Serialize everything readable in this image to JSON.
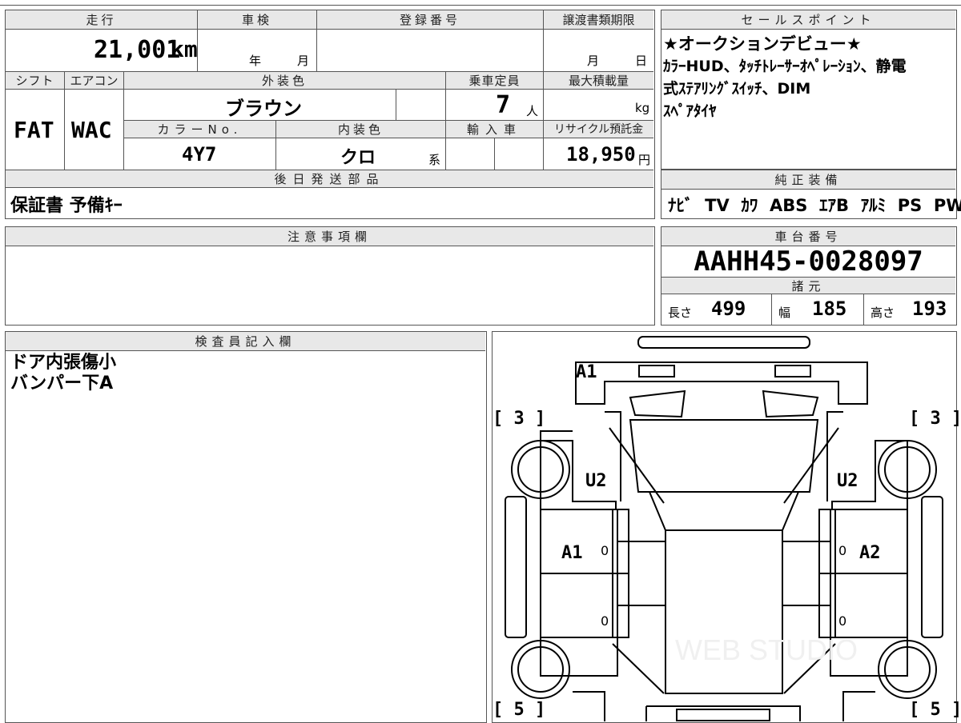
{
  "top": {
    "mileage_label": "走行",
    "mileage_value": "21,001",
    "mileage_unit": "km",
    "inspection_label": "車検",
    "inspection_year": "年",
    "inspection_month": "月",
    "reg_number_label": "登録番号",
    "transfer_deadline_label": "譲渡書類期限",
    "transfer_month": "月",
    "transfer_day": "日",
    "shift_label": "シフト",
    "aircon_label": "エアコン",
    "exterior_color_label": "外装色",
    "capacity_label": "乗車定員",
    "max_load_label": "最大積載量",
    "shift_value": "FAT",
    "aircon_value": "WAC",
    "exterior_color_value": "ブラウン",
    "capacity_value": "7",
    "capacity_unit": "人",
    "max_load_unit": "kg",
    "color_no_label": "カラーNo.",
    "interior_color_label": "内装色",
    "import_label": "輸入車",
    "recycle_label": "リサイクル預託金",
    "color_no_value": "4Y7",
    "interior_color_value": "クロ",
    "interior_color_suffix": "系",
    "recycle_value": "18,950",
    "recycle_unit": "円",
    "later_parts_label": "後日発送部品",
    "later_parts_value": "保証書 予備ｷｰ"
  },
  "sales_points": {
    "label": "セールスポイント",
    "lines": [
      "★オークションデビュー★",
      "ｶﾗｰHUD、ﾀｯﾁﾄﾚｰｻｰｵﾍﾟﾚｰｼｮﾝ、静電",
      "式ｽﾃｱﾘﾝｸﾞｽｲｯﾁ、DIM",
      "ｽﾍﾟｱﾀｲﾔ"
    ]
  },
  "equipment": {
    "label": "純正装備",
    "value": "ﾅﾋﾞ  TV  ｶﾜ  ABS  ｴｱB  ｱﾙﾐ  PS  PW"
  },
  "notes": {
    "label": "注意事項欄"
  },
  "chassis": {
    "label": "車台番号",
    "value": "AAHH45-0028097",
    "spec_label": "諸元",
    "length_label": "長さ",
    "length_value": "499",
    "width_label": "幅",
    "width_value": "185",
    "height_label": "高さ",
    "height_value": "193"
  },
  "inspector": {
    "label": "検査員記入欄",
    "lines": [
      "ドア内張傷小",
      "バンパー下A"
    ]
  },
  "diagram": {
    "tyre_fl": "[ 3 ]",
    "tyre_fr": "[ 3 ]",
    "tyre_rl": "[ 5 ]",
    "tyre_rr": "[ 5 ]",
    "front_mark": "A1",
    "left_front_mark": "U2",
    "right_front_mark": "U2",
    "left_door_mark": "A1",
    "right_door_mark": "A2",
    "zero1": "0",
    "zero2": "0",
    "zero3": "0",
    "zero4": "0"
  }
}
